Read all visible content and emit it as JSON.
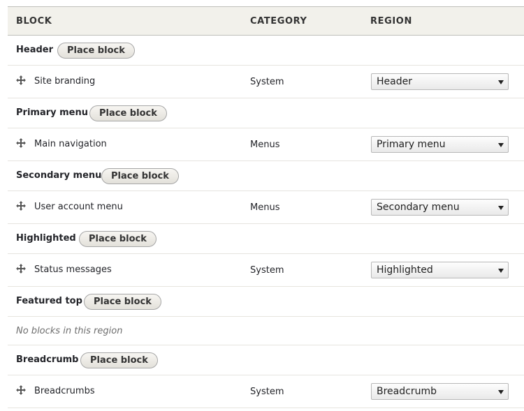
{
  "headers": {
    "block": "BLOCK",
    "category": "CATEGORY",
    "region": "REGION"
  },
  "place_block_label": "Place block",
  "regions": [
    {
      "title": "Header",
      "block": {
        "name": "Site branding",
        "category": "System",
        "region": "Header"
      }
    },
    {
      "title": "Primary menu",
      "block": {
        "name": "Main navigation",
        "category": "Menus",
        "region": "Primary menu"
      }
    },
    {
      "title": "Secondary menu",
      "block": {
        "name": "User account menu",
        "category": "Menus",
        "region": "Secondary menu"
      }
    },
    {
      "title": "Highlighted",
      "block": {
        "name": "Status messages",
        "category": "System",
        "region": "Highlighted"
      }
    },
    {
      "title": "Featured top",
      "empty": "No blocks in this region"
    },
    {
      "title": "Breadcrumb",
      "block": {
        "name": "Breadcrumbs",
        "category": "System",
        "region": "Breadcrumb"
      }
    }
  ],
  "icons": {
    "drag": "move-arrows-icon",
    "dropdown": "chevron-down-icon"
  }
}
